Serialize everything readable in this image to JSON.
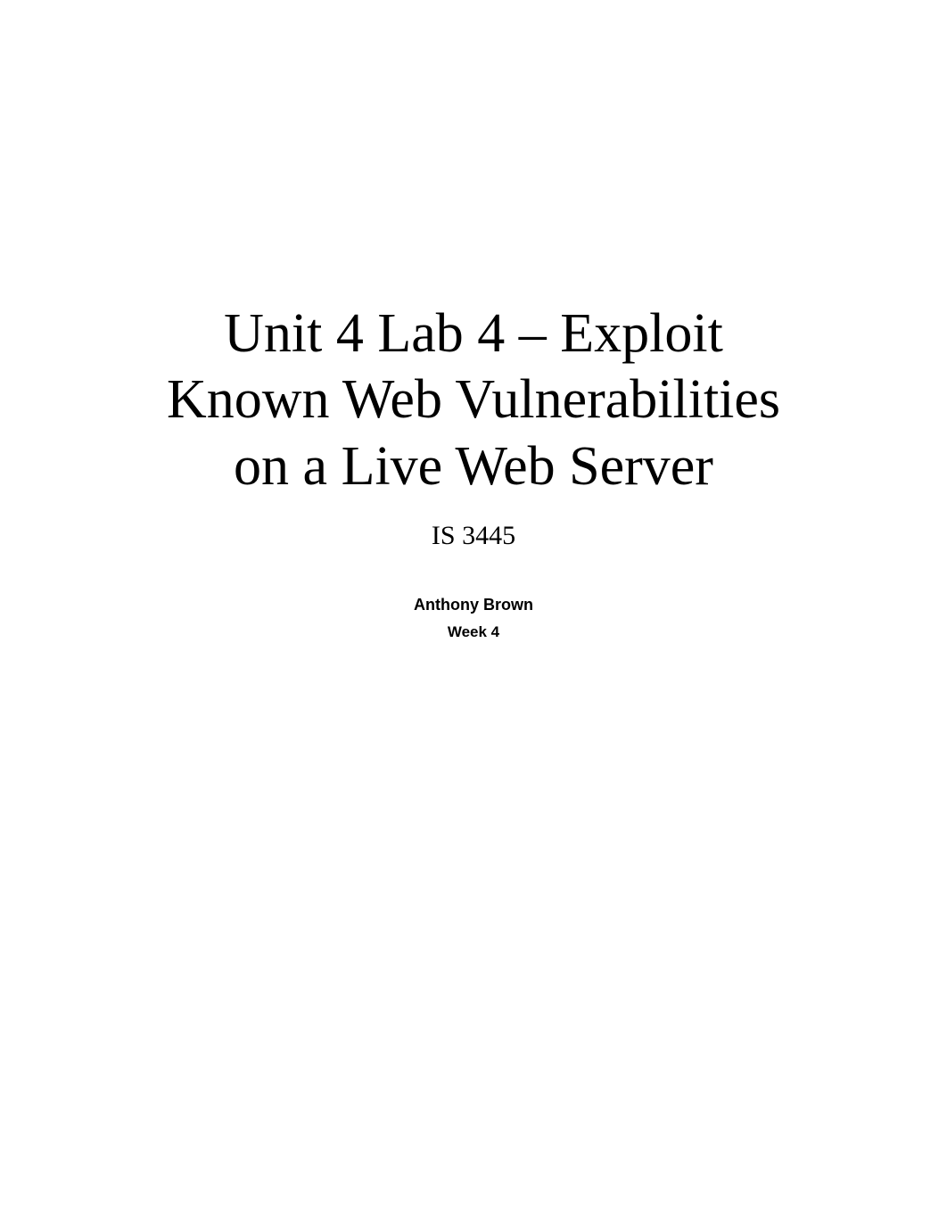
{
  "title_line1": "Unit 4 Lab 4 – Exploit",
  "title_line2": "Known Web Vulnerabilities",
  "title_line3": "on a Live Web Server",
  "course_code": "IS 3445",
  "author": "Anthony Brown",
  "week": "Week 4"
}
